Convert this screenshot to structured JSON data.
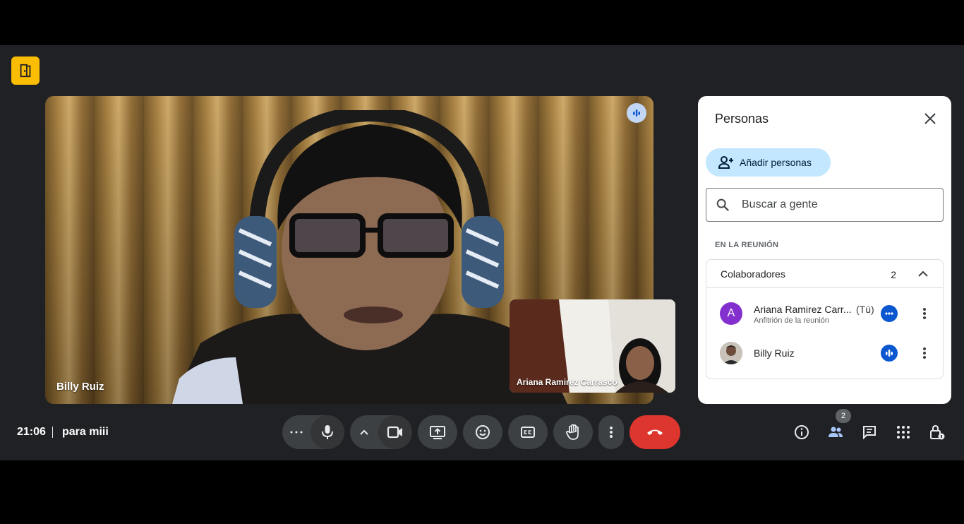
{
  "main_video": {
    "participant_name": "Billy Ruiz"
  },
  "self_tile": {
    "participant_name": "Ariana Ramirez Carrasco"
  },
  "people_panel": {
    "title": "Personas",
    "add_people_label": "Añadir personas",
    "search_placeholder": "Buscar a gente",
    "section_label": "EN LA REUNIÓN",
    "group": {
      "label": "Colaboradores",
      "count": "2"
    },
    "participants": [
      {
        "name": "Ariana Ramirez Carr...",
        "you_tag": "(Tú)",
        "role": "Anfitrión de la reunión",
        "avatar_letter": "A",
        "avatar_color": "#8430ce",
        "status_icon": "more-horiz-icon"
      },
      {
        "name": "Billy Ruiz",
        "you_tag": "",
        "role": "",
        "avatar_letter": "",
        "avatar_color": "#9aa0a6",
        "status_icon": "audio-level-icon"
      }
    ]
  },
  "bottom_bar": {
    "time": "21:06",
    "meeting_name": "para miii",
    "people_count": "2"
  },
  "colors": {
    "background": "#202124",
    "end_call": "#dc362e",
    "accent_blue": "#0b57d0",
    "add_button_bg": "#c2e7ff",
    "logo_badge": "#fbbc04"
  }
}
